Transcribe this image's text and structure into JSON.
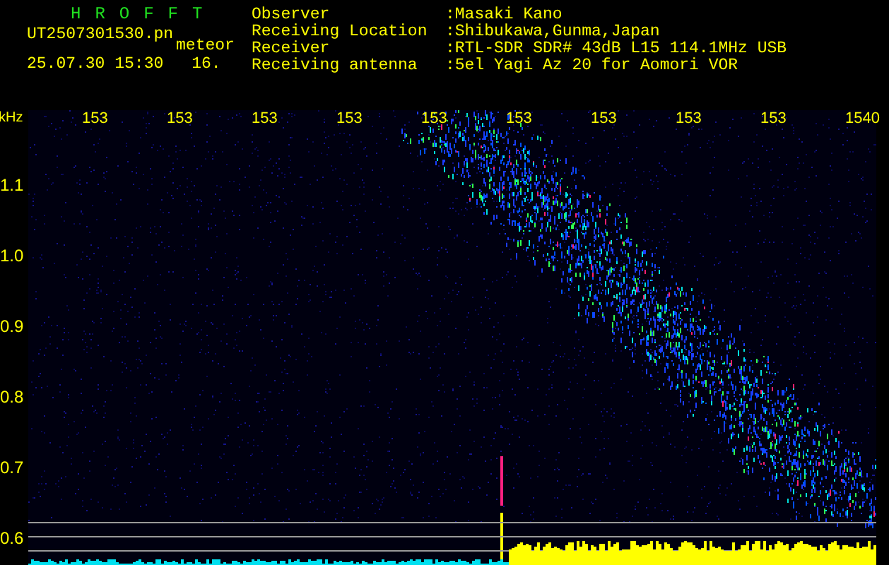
{
  "header": {
    "title": "HROFFT",
    "file_name": "UT2507301530.pn",
    "tag": "meteor",
    "timestamp": "25.07.30 15:30",
    "value": "16."
  },
  "info": [
    {
      "label": "Observer",
      "value": ":Masaki Kano"
    },
    {
      "label": "Receiving Location",
      "value": ":Shibukawa,Gunma,Japan"
    },
    {
      "label": "Receiver",
      "value": ":RTL-SDR SDR# 43dB L15 114.1MHz USB"
    },
    {
      "label": "Receiving antenna",
      "value": ":5el Yagi Az 20 for Aomori VOR"
    }
  ],
  "y_axis": {
    "unit": "kHz",
    "ticks": [
      "1.1",
      "1.0",
      "0.9",
      "0.8",
      "0.7",
      "0.6"
    ]
  },
  "x_axis": {
    "ticks": [
      "153",
      "153",
      "153",
      "153",
      "153",
      "153",
      "153",
      "153",
      "153",
      "1540"
    ]
  }
}
